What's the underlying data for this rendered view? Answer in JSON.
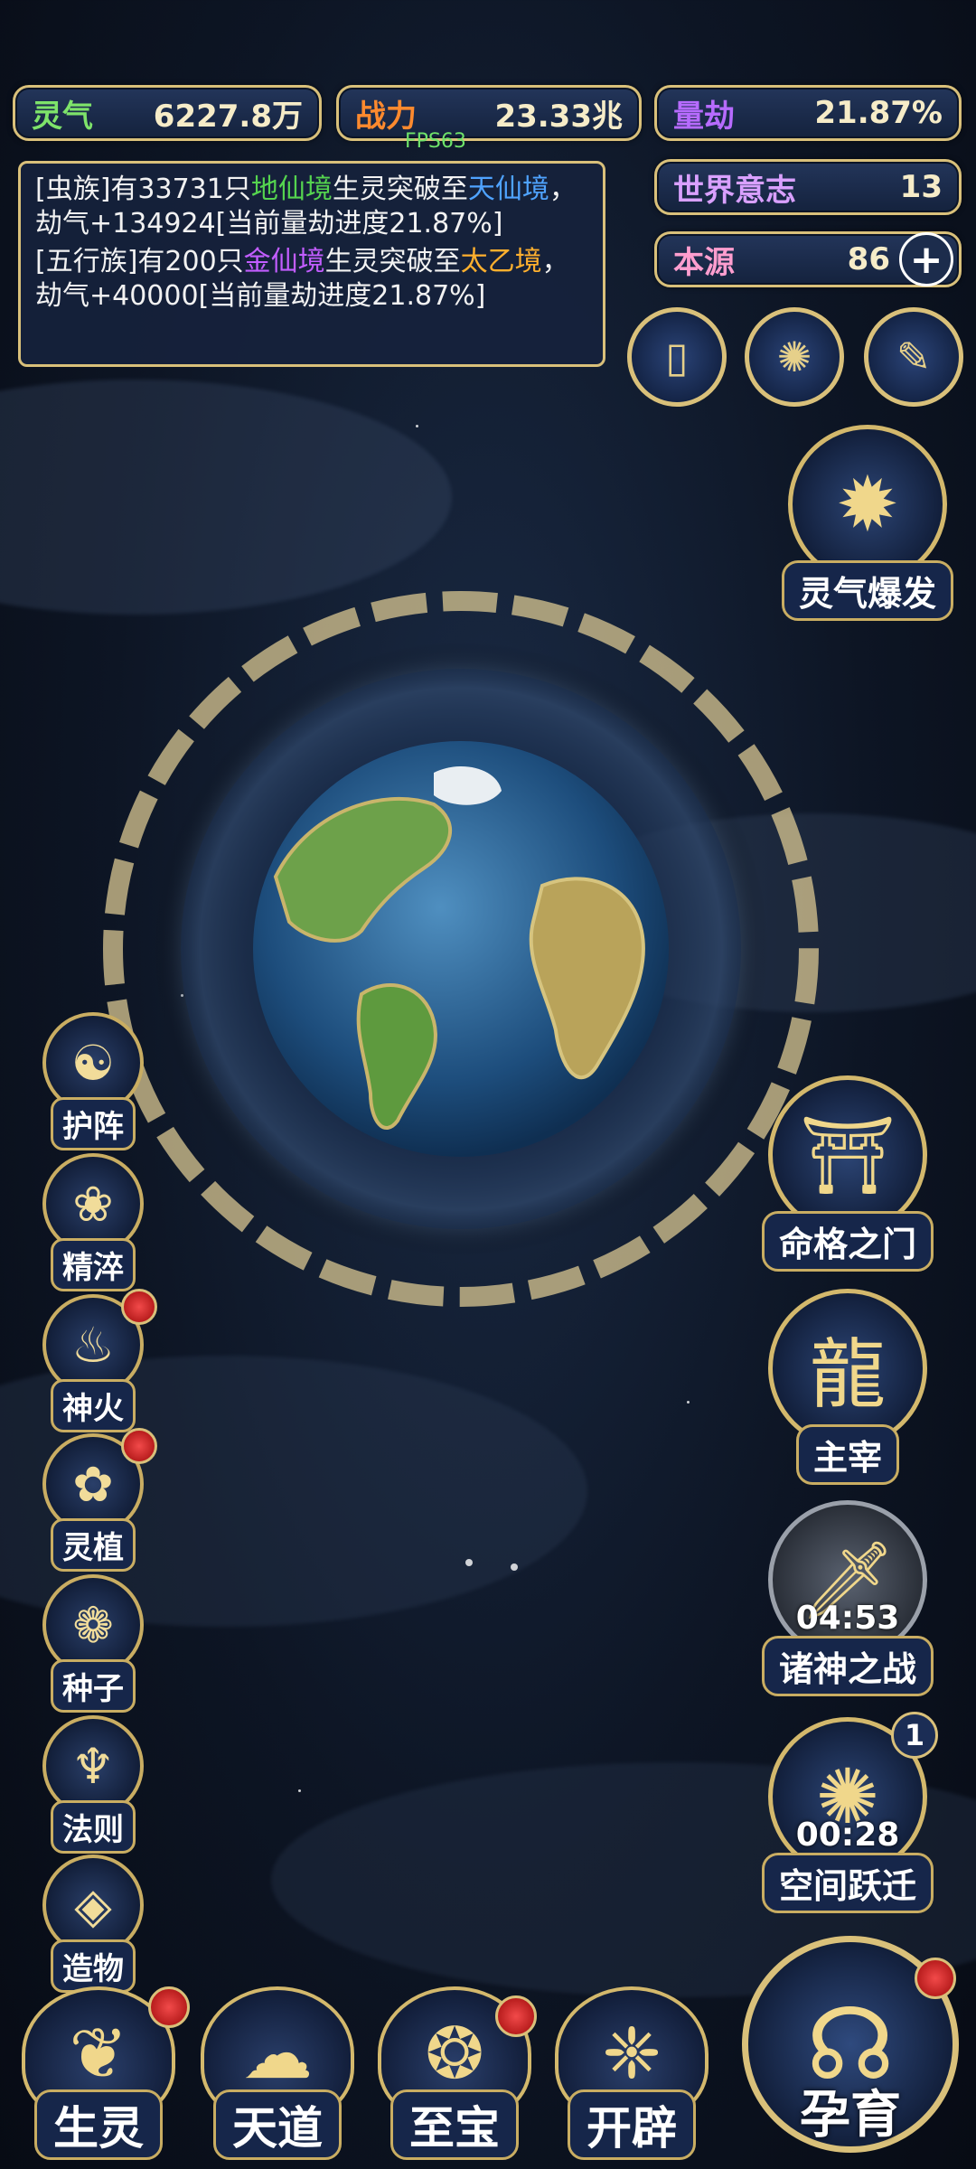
{
  "stats": {
    "lingqi": {
      "label": "灵气",
      "value": "6227.8万",
      "color": "#7ee36a"
    },
    "zhanli": {
      "label": "战力",
      "value": "23.33兆",
      "color": "#ff8a2e"
    },
    "liangjie": {
      "label": "量劫",
      "value": "21.87%",
      "color": "#b76bff"
    },
    "world_will": {
      "label": "世界意志",
      "value": "13",
      "color": "#d9a0ff"
    },
    "benyuan": {
      "label": "本源",
      "value": "86",
      "color": "#ff9ecf"
    }
  },
  "fps": "FPS63",
  "log": [
    {
      "p1": "[虫族]有33731只",
      "realm1": "地仙境",
      "p2": "生灵突破至",
      "realm2": "天仙境",
      "p3": "，劫气+134924[当前量劫进度21.87%]"
    },
    {
      "p1": "[五行族]有200只",
      "realm1": "金仙境",
      "p2": "生灵突破至",
      "realm2": "太乙境",
      "p3": "，劫气+40000[当前量劫进度21.87%]"
    }
  ],
  "top_icons": [
    "book-icon",
    "portal-icon",
    "scroll-icon"
  ],
  "plus": "+",
  "left_menu": [
    {
      "label": "护阵",
      "icon": "yin-yang-icon",
      "badge": false
    },
    {
      "label": "精淬",
      "icon": "lotus-flame-icon",
      "badge": false
    },
    {
      "label": "神火",
      "icon": "fire-icon",
      "badge": true
    },
    {
      "label": "灵植",
      "icon": "plant-icon",
      "badge": true
    },
    {
      "label": "种子",
      "icon": "seed-icon",
      "badge": false
    },
    {
      "label": "法则",
      "icon": "rule-icon",
      "badge": false
    },
    {
      "label": "造物",
      "icon": "create-icon",
      "badge": false
    }
  ],
  "right_menu": {
    "burst": "灵气爆发",
    "fate_gate": "命格之门",
    "ruler": "主宰",
    "gods_war": {
      "label": "诸神之战",
      "timer": "04:53"
    },
    "space_jump": {
      "label": "空间跃迁",
      "timer": "00:28",
      "count": "1"
    }
  },
  "bottom_menu": [
    {
      "label": "生灵",
      "icon": "life-icon",
      "badge": true
    },
    {
      "label": "天道",
      "icon": "dao-icon",
      "badge": false
    },
    {
      "label": "至宝",
      "icon": "treasure-icon",
      "badge": true
    },
    {
      "label": "开辟",
      "icon": "open-icon",
      "badge": false
    }
  ],
  "incubate": "孕育"
}
